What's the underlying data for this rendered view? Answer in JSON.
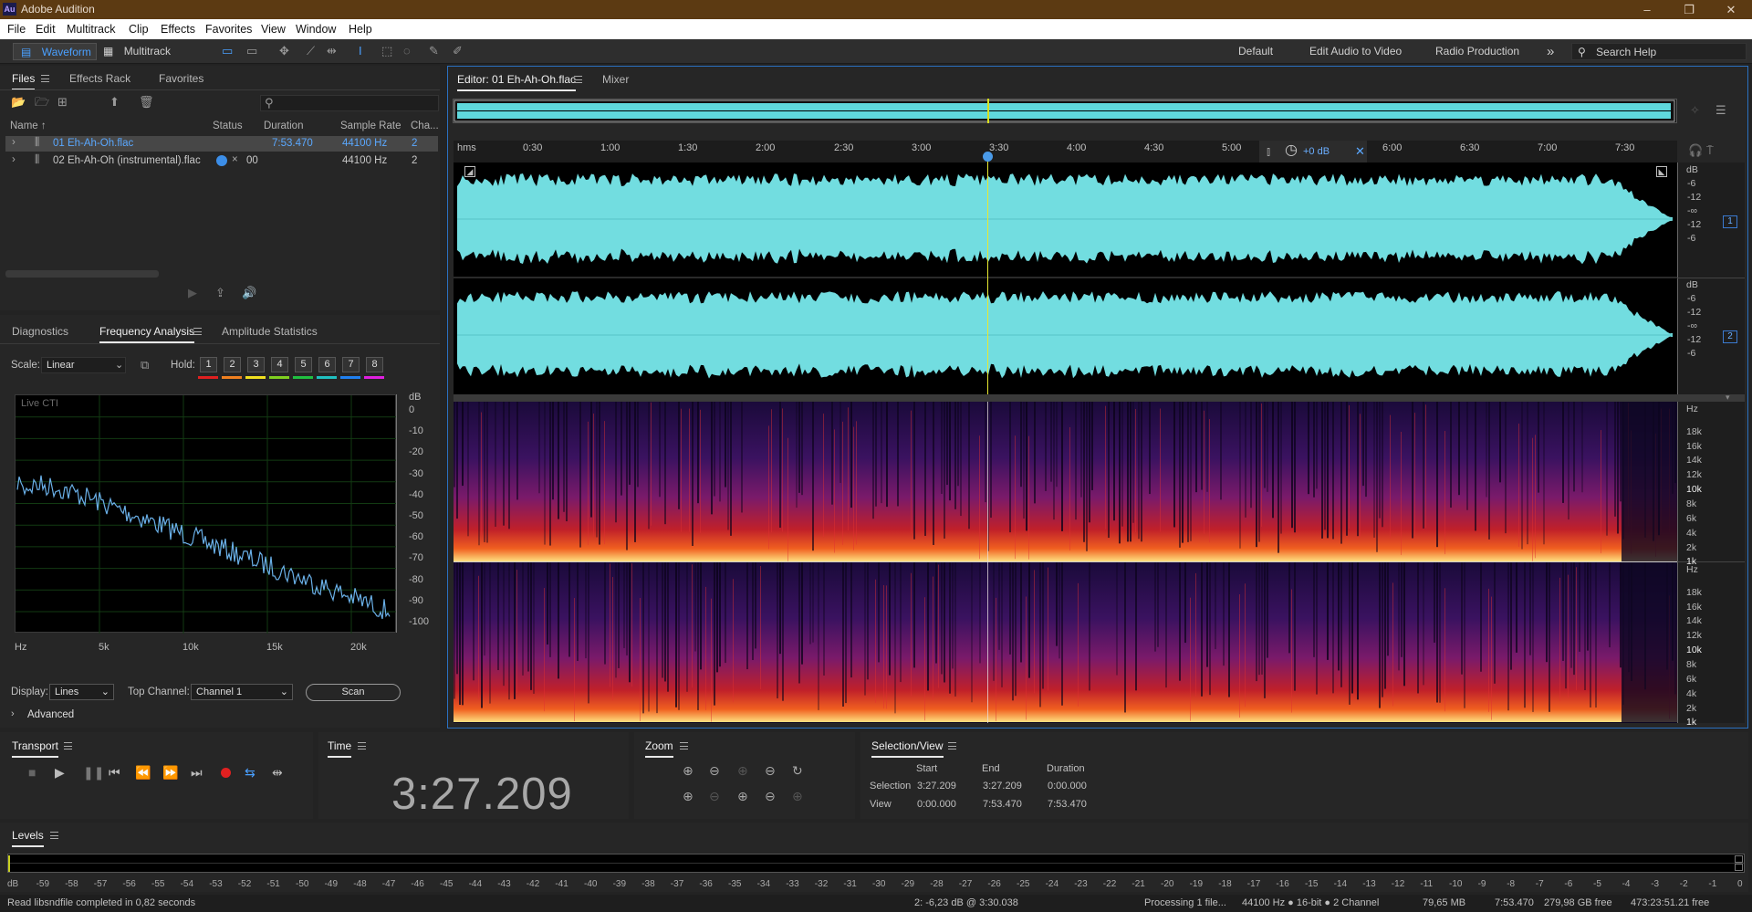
{
  "app": {
    "logo": "Au",
    "title": "Adobe Audition",
    "window_controls": [
      "–",
      "❐",
      "✕"
    ]
  },
  "menu": [
    "File",
    "Edit",
    "Multitrack",
    "Clip",
    "Effects",
    "Favorites",
    "View",
    "Window",
    "Help"
  ],
  "toolbar": {
    "waveform": "Waveform",
    "multitrack": "Multitrack",
    "workspaces": [
      "Default",
      "Edit Audio to Video",
      "Radio Production"
    ],
    "more": "»",
    "search_placeholder": "Search Help"
  },
  "files_panel": {
    "tabs": [
      "Files",
      "Effects Rack",
      "Favorites"
    ],
    "columns": {
      "name": "Name ↑",
      "status": "Status",
      "duration": "Duration",
      "rate": "Sample Rate",
      "ch": "Cha..."
    },
    "files": [
      {
        "name": "01 Eh-Ah-Oh.flac",
        "status": "",
        "duration": "7:53.470",
        "rate": "44100 Hz",
        "ch": "2"
      },
      {
        "name": "02 Eh-Ah-Oh (instrumental).flac",
        "status": "00",
        "duration": "",
        "rate": "44100 Hz",
        "ch": "2"
      }
    ]
  },
  "analysis_panel": {
    "tabs": [
      "Diagnostics",
      "Frequency Analysis",
      "Amplitude Statistics"
    ],
    "scale_label": "Scale:",
    "scale_value": "Linear",
    "hold_label": "Hold:",
    "hold": [
      "1",
      "2",
      "3",
      "4",
      "5",
      "6",
      "7",
      "8"
    ],
    "hold_colors": [
      "#e02020",
      "#f08020",
      "#f0e020",
      "#80d020",
      "#20c040",
      "#20c0c0",
      "#2080f0",
      "#e020e0"
    ],
    "graph_label": "Live CTI",
    "db_unit": "dB",
    "db_ticks": [
      "0",
      "-10",
      "-20",
      "-30",
      "-40",
      "-50",
      "-60",
      "-70",
      "-80",
      "-90",
      "-100"
    ],
    "freq_ticks": [
      "Hz",
      "5k",
      "10k",
      "15k",
      "20k"
    ],
    "display_label": "Display:",
    "display_value": "Lines",
    "top_channel_label": "Top Channel:",
    "top_channel_value": "Channel 1",
    "scan": "Scan",
    "advanced": "Advanced"
  },
  "editor": {
    "tabs": [
      "Editor: 01 Eh-Ah-Oh.flac",
      "Mixer"
    ],
    "ruler": [
      "hms",
      "0:30",
      "1:00",
      "1:30",
      "2:00",
      "2:30",
      "3:00",
      "3:30",
      "4:00",
      "4:30",
      "5:00",
      "6:00",
      "6:30",
      "7:00",
      "7:30"
    ],
    "gain": "+0 dB",
    "db_ticks": [
      "dB",
      "-6",
      "-12",
      "-∞",
      "-12",
      "-6"
    ],
    "channels": [
      "1",
      "2"
    ],
    "hz_ticks": [
      "Hz",
      "18k",
      "16k",
      "14k",
      "12k",
      "10k",
      "8k",
      "6k",
      "4k",
      "2k",
      "1k"
    ]
  },
  "transport": {
    "title": "Transport"
  },
  "time": {
    "title": "Time",
    "value": "3:27.209"
  },
  "zoom": {
    "title": "Zoom"
  },
  "selection": {
    "title": "Selection/View",
    "start": "Start",
    "end": "End",
    "duration": "Duration",
    "rows": [
      {
        "label": "Selection",
        "start": "3:27.209",
        "end": "3:27.209",
        "duration": "0:00.000"
      },
      {
        "label": "View",
        "start": "0:00.000",
        "end": "7:53.470",
        "duration": "7:53.470"
      }
    ]
  },
  "levels": {
    "title": "Levels",
    "scale": [
      "dB",
      "-59",
      "-58",
      "-57",
      "-56",
      "-55",
      "-54",
      "-53",
      "-52",
      "-51",
      "-50",
      "-49",
      "-48",
      "-47",
      "-46",
      "-45",
      "-44",
      "-43",
      "-42",
      "-41",
      "-40",
      "-39",
      "-38",
      "-37",
      "-36",
      "-35",
      "-34",
      "-33",
      "-32",
      "-31",
      "-30",
      "-29",
      "-28",
      "-27",
      "-26",
      "-25",
      "-24",
      "-23",
      "-22",
      "-21",
      "-20",
      "-19",
      "-18",
      "-17",
      "-16",
      "-15",
      "-14",
      "-13",
      "-12",
      "-11",
      "-10",
      "-9",
      "-8",
      "-7",
      "-6",
      "-5",
      "-4",
      "-3",
      "-2",
      "-1",
      "0"
    ]
  },
  "status": {
    "message": "Read libsndfile completed in 0,82 seconds",
    "cursor": "2: -6,23 dB @ 3:30.038",
    "processing": "Processing 1 file...",
    "format": "44100 Hz ● 16-bit ● 2 Channel",
    "size": "79,65 MB",
    "length": "7:53.470",
    "free": "279,98 GB free",
    "free_time": "473:23:51.21 free"
  }
}
